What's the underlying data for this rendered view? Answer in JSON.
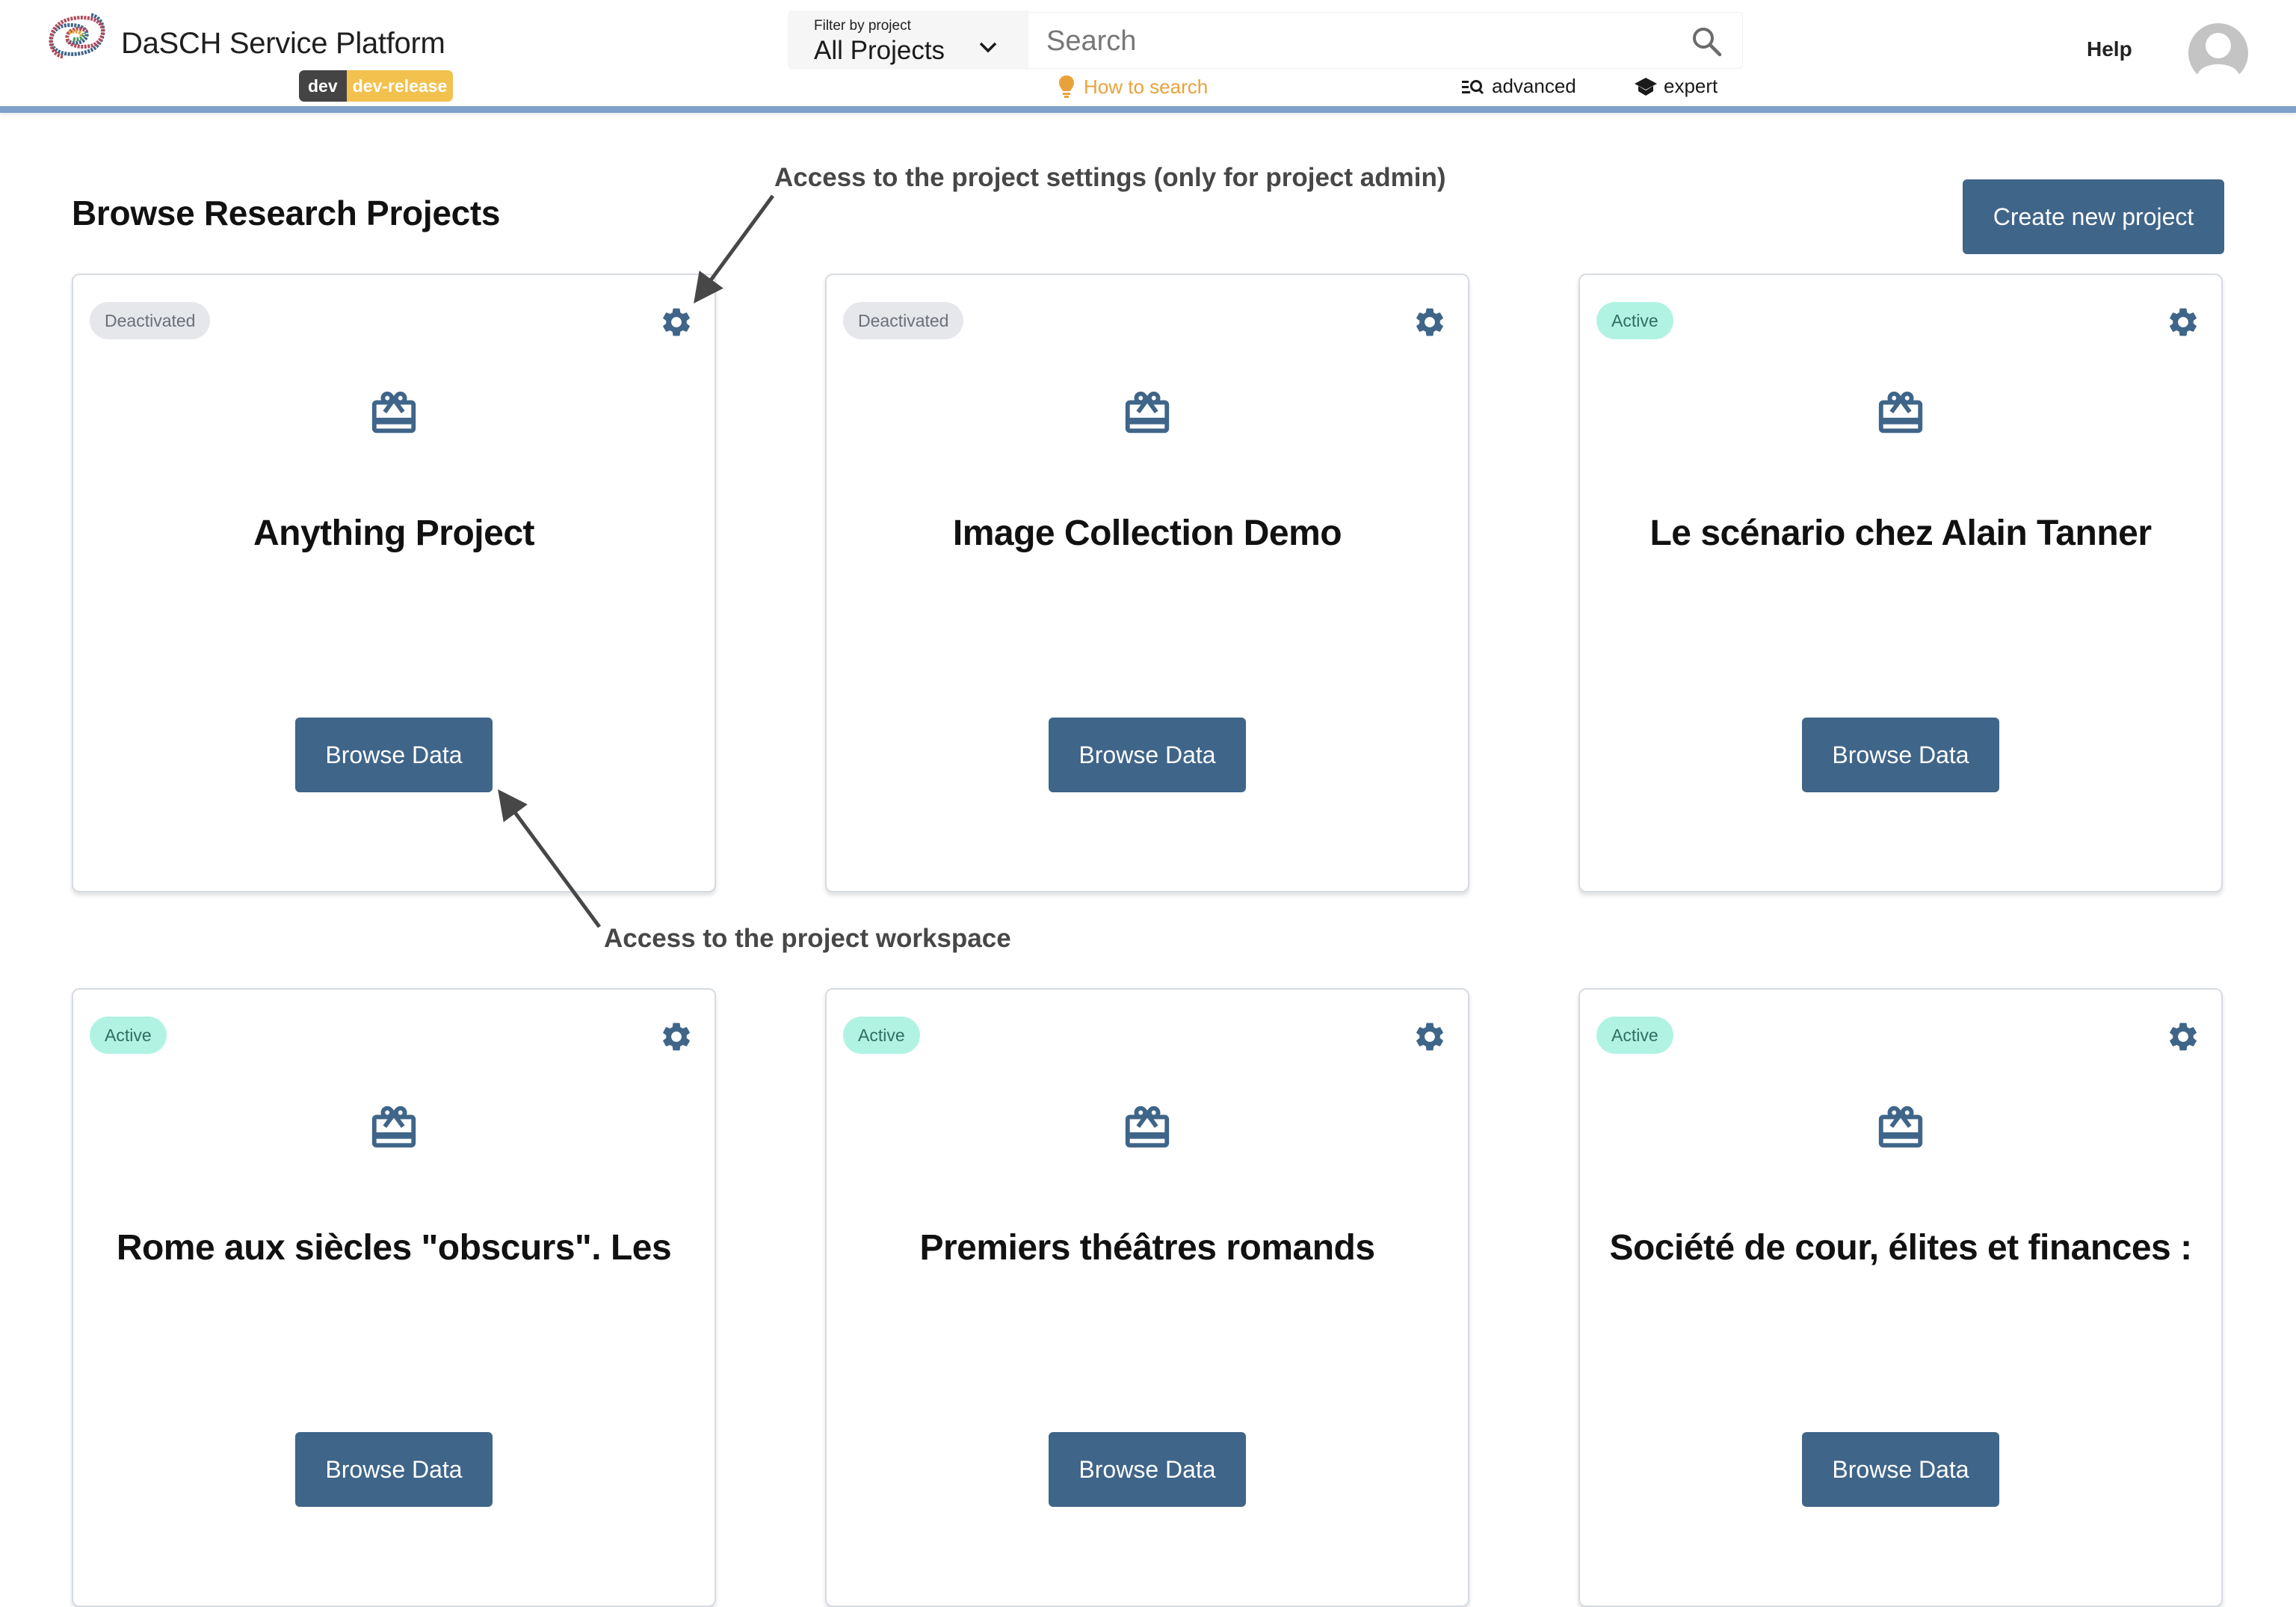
{
  "header": {
    "app_title": "DaSCH Service Platform",
    "env_badge": {
      "env": "dev",
      "release": "dev-release"
    },
    "filter": {
      "label": "Filter by project",
      "value": "All Projects"
    },
    "search": {
      "placeholder": "Search",
      "value": ""
    },
    "how_to_search": "How to search",
    "advanced": "advanced",
    "expert": "expert",
    "help": "Help",
    "icons": {
      "logo": "dasch-logo-icon",
      "chevron": "chevron-down-icon",
      "search": "search-icon",
      "how_to_search": "lightbulb-icon",
      "advanced": "manage-search-icon",
      "expert": "school-icon",
      "avatar": "account-circle-icon"
    }
  },
  "main": {
    "title": "Browse Research Projects",
    "create_button": "Create new project",
    "projects": [
      {
        "status": "Deactivated",
        "status_key": "deactivated",
        "title": "Anything Project",
        "button": "Browse Data"
      },
      {
        "status": "Deactivated",
        "status_key": "deactivated",
        "title": "Image Collection Demo",
        "button": "Browse Data"
      },
      {
        "status": "Active",
        "status_key": "active",
        "title": "Le scénario chez Alain Tanner",
        "button": "Browse Data"
      },
      {
        "status": "Active",
        "status_key": "active",
        "title": "Rome aux siècles \"obscurs\". Les",
        "button": "Browse Data"
      },
      {
        "status": "Active",
        "status_key": "active",
        "title": "Premiers théâtres romands",
        "button": "Browse Data"
      },
      {
        "status": "Active",
        "status_key": "active",
        "title": "Société de cour, élites et finances :",
        "button": "Browse Data"
      }
    ]
  },
  "annotations": {
    "settings": "Access to the project settings (only for project admin)",
    "workspace": "Access to the project workspace"
  },
  "colors": {
    "primary": "#3f6589",
    "header_bar": "#7fa0c8",
    "active_badge_bg": "#b1f3e3",
    "deactivated_badge_bg": "#e5e7eb",
    "how_to_search": "#e9a23b",
    "env_dev": "#444444",
    "env_release": "#f2c14e"
  }
}
